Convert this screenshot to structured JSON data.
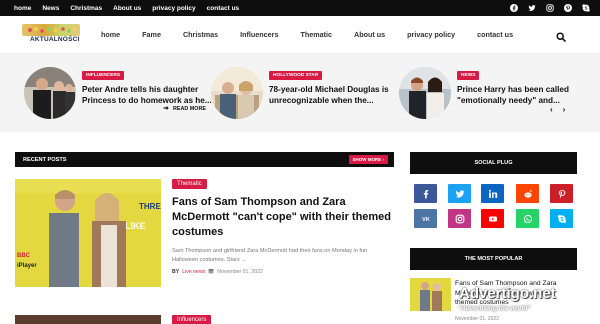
{
  "topnav": [
    "home",
    "News",
    "Christmas",
    "About us",
    "privacy policy",
    "contact us"
  ],
  "top_social_icons": [
    "facebook-icon",
    "twitter-icon",
    "instagram-icon",
    "pinterest-icon",
    "skype-icon"
  ],
  "logo": {
    "text": "AKTUALNOŚCI"
  },
  "mainnav": [
    "home",
    "Fame",
    "Christmas",
    "Influencers",
    "Thematic",
    "About us",
    "privacy policy",
    "contact us"
  ],
  "ticker": [
    {
      "category": "INFLUENCERS",
      "title": "Peter Andre tells his daughter Princess to do homework as he..."
    },
    {
      "category": "HOLLYWOOD STAR",
      "title": "78-year-old Michael Douglas is unrecognizable when the..."
    },
    {
      "category": "NEWS",
      "title": "Prince Harry has been called \"emotionally needy\" and..."
    }
  ],
  "recent": {
    "label": "RECENT POSTS",
    "show_more": "SHOW MORE ›"
  },
  "post": {
    "category": "Thematic",
    "title": "Fans of Sam Thompson and Zara McDermott \"can't cope\" with their themed costumes",
    "excerpt": "Sam Thompson and girlfriend Zara McDermott had their fans on Monday in fun Halloween costumes. Stars ...",
    "by": "BY",
    "author": "Live news",
    "date": "November 01, 2022",
    "read_more": "READ MORE"
  },
  "post2": {
    "category": "Influencers"
  },
  "sidebar": {
    "social_title": "SOCIAL PLUG",
    "social": [
      {
        "name": "facebook",
        "color": "#3b5998"
      },
      {
        "name": "twitter",
        "color": "#1da1f2"
      },
      {
        "name": "linkedin",
        "color": "#0a66c2"
      },
      {
        "name": "reddit",
        "color": "#ff4500"
      },
      {
        "name": "pinterest",
        "color": "#cb2027"
      },
      {
        "name": "vk",
        "color": "#4c75a3"
      },
      {
        "name": "instagram",
        "color": "#c13584"
      },
      {
        "name": "youtube",
        "color": "#ff0000"
      },
      {
        "name": "whatsapp",
        "color": "#25d366"
      },
      {
        "name": "skype",
        "color": "#00aff0"
      }
    ],
    "popular_title": "THE MOST POPULAR",
    "popular": {
      "title": "Fans of Sam Thompson and Zara McDermott \"can't cope\" with their themed costumes",
      "date": "November 01, 2022"
    }
  },
  "watermark": {
    "line1": "Advertigo.net",
    "line2": "\"Advertising the world\""
  }
}
